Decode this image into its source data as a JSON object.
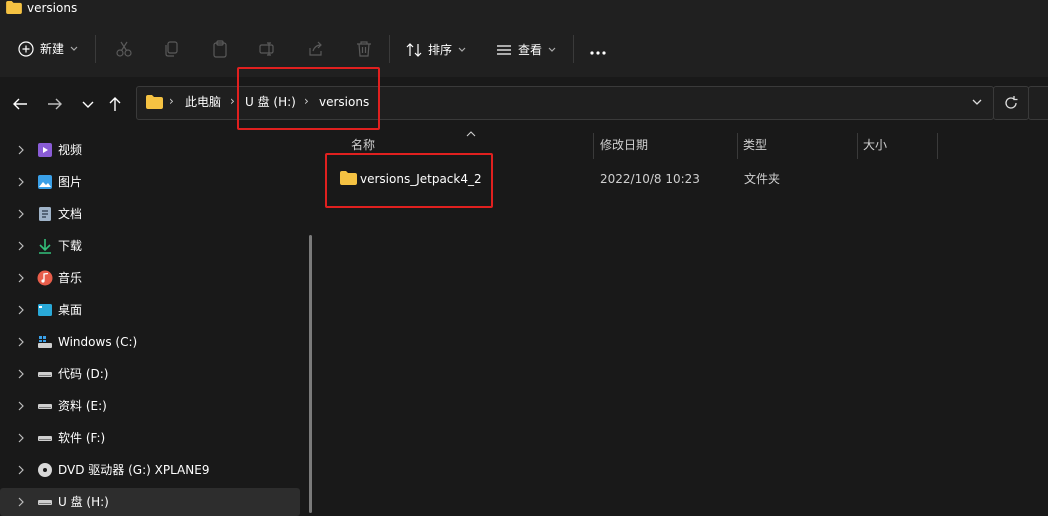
{
  "window": {
    "title": "versions"
  },
  "toolbar": {
    "new_label": "新建",
    "sort_label": "排序",
    "view_label": "查看",
    "icons": [
      "cut-icon",
      "copy-icon",
      "paste-icon",
      "rename-icon",
      "share-icon",
      "delete-icon"
    ],
    "more_label": "···"
  },
  "address": {
    "crumbs": [
      "此电脑",
      "U 盘 (H:)",
      "versions"
    ],
    "separator": "›"
  },
  "sidebar": {
    "items": [
      {
        "label": "视频"
      },
      {
        "label": "图片"
      },
      {
        "label": "文档"
      },
      {
        "label": "下载"
      },
      {
        "label": "音乐"
      },
      {
        "label": "桌面"
      },
      {
        "label": "Windows (C:)"
      },
      {
        "label": "代码 (D:)"
      },
      {
        "label": "资料 (E:)"
      },
      {
        "label": "软件 (F:)"
      },
      {
        "label": "DVD 驱动器 (G:) XPLANE9"
      },
      {
        "label": "U 盘 (H:)"
      }
    ]
  },
  "columns": {
    "name": "名称",
    "modified": "修改日期",
    "type": "类型",
    "size": "大小"
  },
  "files": [
    {
      "name": "versions_Jetpack4_2",
      "modified": "2022/10/8 10:23",
      "type": "文件夹"
    }
  ],
  "colors": {
    "accent_highlight": "#e0201f",
    "folder": "#f5c242"
  }
}
